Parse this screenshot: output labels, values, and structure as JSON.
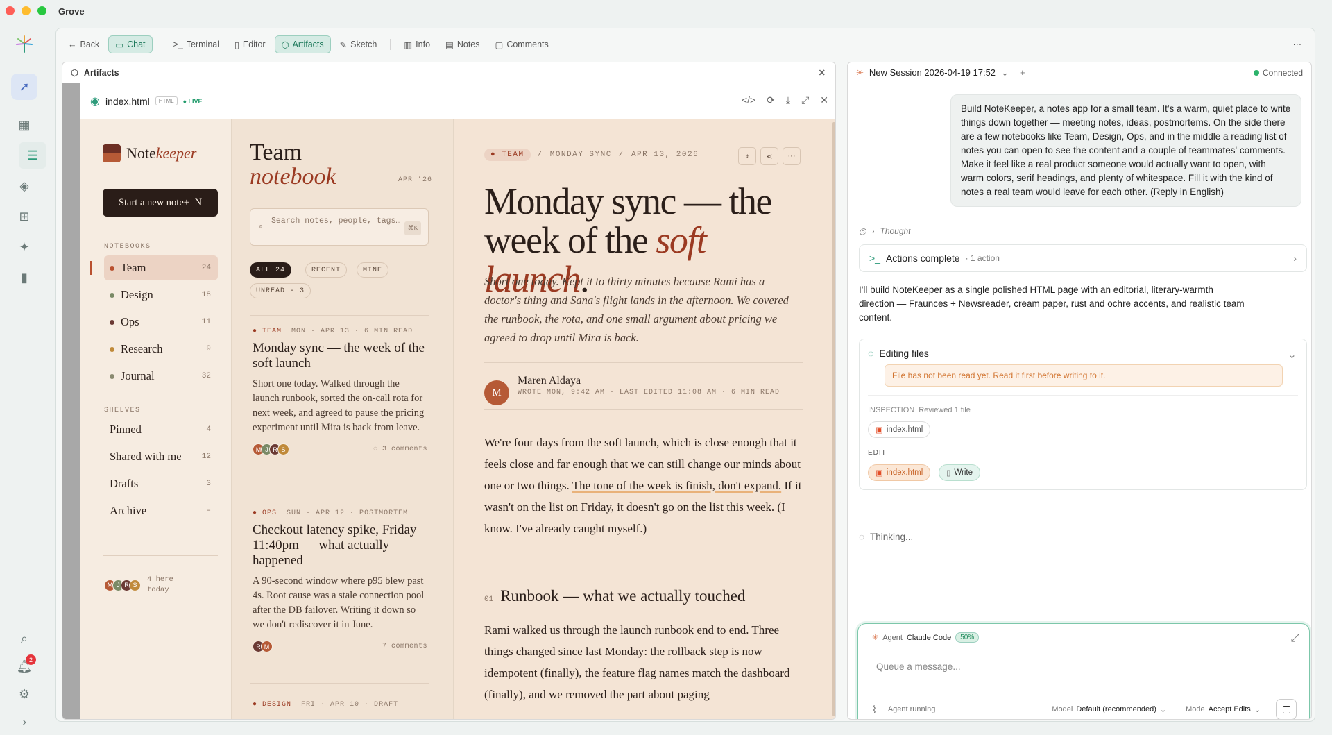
{
  "window": {
    "title": "Grove"
  },
  "toolbar": {
    "back": "Back",
    "tabs": [
      "Chat",
      "Terminal",
      "Editor",
      "Artifacts",
      "Sketch",
      "Info",
      "Notes",
      "Comments"
    ]
  },
  "artifacts_panel": {
    "title": "Artifacts",
    "file_name": "index.html",
    "file_type": "HTML",
    "live": "LIVE"
  },
  "notekeeper": {
    "brand_a": "Note",
    "brand_b": "keeper",
    "new_note": "Start a new note+",
    "new_note_kbd": "N",
    "notebooks_label": "NOTEBOOKS",
    "notebooks": [
      {
        "name": "Team",
        "count": "24",
        "color": "#b9502f"
      },
      {
        "name": "Design",
        "count": "18",
        "color": "#7a8a66"
      },
      {
        "name": "Ops",
        "count": "11",
        "color": "#6b3a34"
      },
      {
        "name": "Research",
        "count": "9",
        "color": "#c08a3a"
      },
      {
        "name": "Journal",
        "count": "32",
        "color": "#8a8a70"
      }
    ],
    "shelves_label": "SHELVES",
    "shelves": [
      {
        "name": "Pinned",
        "count": "4"
      },
      {
        "name": "Shared with me",
        "count": "12"
      },
      {
        "name": "Drafts",
        "count": "3"
      },
      {
        "name": "Archive",
        "count": "–"
      }
    ],
    "presence_avatars": [
      "M",
      "J",
      "R",
      "S"
    ],
    "presence_text": "4 here today"
  },
  "notelist": {
    "title_a": "Team",
    "title_b": "notebook",
    "date": "APR ’26",
    "search_placeholder": "Search notes, people, tags…",
    "search_kbd": "⌘K",
    "filters": [
      "ALL 24",
      "RECENT",
      "MINE",
      "UNREAD · 3"
    ],
    "notes": [
      {
        "tag": "TEAM",
        "meta": "MON · APR 13 · 6 MIN READ",
        "title": "Monday sync — the week of the soft launch",
        "excerpt": "Short one today. Walked through the launch runbook, sorted the on-call rota for next week, and agreed to pause the pricing experiment until Mira is back from leave.",
        "avatars": [
          "M",
          "J",
          "R",
          "S"
        ],
        "comments": "3 comments"
      },
      {
        "tag": "OPS",
        "meta": "SUN · APR 12 · POSTMORTEM",
        "title": "Checkout latency spike, Friday 11:40pm — what actually happened",
        "excerpt": "A 90-second window where p95 blew past 4s. Root cause was a stale connection pool after the DB failover. Writing it down so we don't rediscover it in June.",
        "avatars": [
          "R",
          "M"
        ],
        "comments": "7 comments"
      },
      {
        "tag": "DESIGN",
        "meta": "FRI · APR 10 · DRAFT"
      }
    ]
  },
  "note": {
    "tag": "TEAM",
    "crumb": "MONDAY SYNC",
    "date": "APR 13, 2026",
    "title_a": "Monday sync — the week of the ",
    "title_b": "soft launch",
    "title_c": ".",
    "lede": "Short one today. Kept it to thirty minutes because Rami has a doctor's thing and Sana's flight lands in the afternoon. We covered the runbook, the rota, and one small argument about pricing we agreed to drop until Mira is back.",
    "author": "Maren Aldaya",
    "author_initial": "M",
    "author_meta": "WROTE MON, 9:42 AM · LAST EDITED 11:08 AM · 6 MIN READ",
    "p1_a": "We're four days from the soft launch, which is close enough that it feels close and far enough that we can still change our minds about one or two things. ",
    "p1_hl": "The tone of the week is finish, don't expand.",
    "p1_b": " If it wasn't on the list on Friday, it doesn't go on the list this week. (I know. I've already caught myself.)",
    "h2_num": "01",
    "h2": "Runbook — what we actually touched",
    "p2": "Rami walked us through the launch runbook end to end. Three things changed since last Monday: the rollback step is now idempotent (finally), the feature flag names match the dashboard (finally), and we removed the part about paging"
  },
  "session": {
    "title": "New Session 2026-04-19 17:52",
    "status": "Connected",
    "user_message": "Build NoteKeeper, a notes app for a small team. It's a warm, quiet place to write things down together — meeting notes, ideas, postmortems. On the side there are a few notebooks like Team, Design, Ops, and in the middle a reading list of notes you can open to see the content and a couple of teammates' comments. Make it feel like a real product someone would actually want to open, with warm colors, serif headings, and plenty of whitespace. Fill it with the kind of notes a real team would leave for each other. (Reply in English)",
    "thought": "Thought",
    "actions": "Actions complete",
    "actions_sub": "· 1 action",
    "agent_text": "I'll build NoteKeeper as a single polished HTML page with an editorial, literary-warmth direction — Fraunces + Newsreader, cream paper, rust and ochre accents, and realistic team content.",
    "editing": "Editing files",
    "warning": "File has not been read yet. Read it first before writing to it.",
    "inspection_label": "INSPECTION",
    "inspection_sub": "Reviewed 1 file",
    "inspection_file": "index.html",
    "edit_label": "EDIT",
    "edit_file": "index.html",
    "edit_action": "Write",
    "thinking": "Thinking..."
  },
  "composer": {
    "agent_label": "Agent",
    "agent_name": "Claude Code",
    "agent_pct": "50%",
    "placeholder": "Queue a message...",
    "status": "Agent running",
    "model_label": "Model",
    "model_value": "Default (recommended)",
    "mode_label": "Mode",
    "mode_value": "Accept Edits"
  },
  "rail": {
    "notification_count": "2"
  }
}
